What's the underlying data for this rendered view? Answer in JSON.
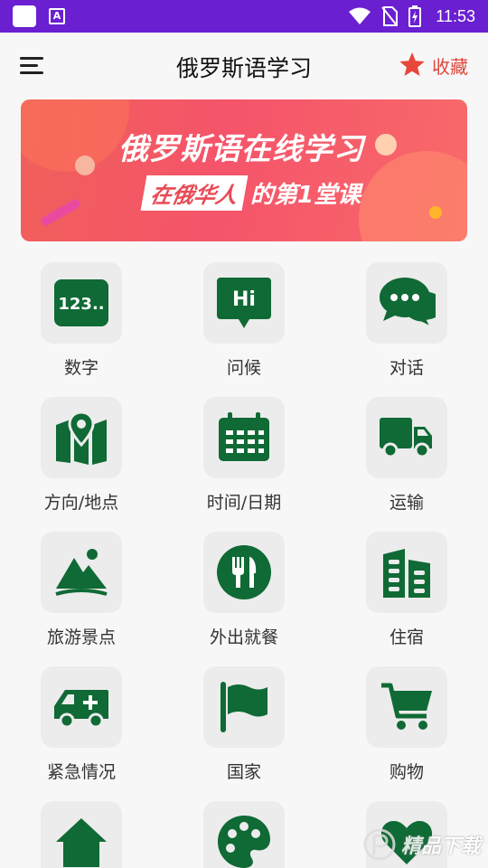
{
  "status_bar": {
    "time": "11:53",
    "app_glyph": "A"
  },
  "header": {
    "title": "俄罗斯语学习",
    "favorite_label": "收藏"
  },
  "banner": {
    "line1": "俄罗斯语在线学习",
    "chip": "在俄华人",
    "line2_rest": "的第1堂课"
  },
  "grid": {
    "items": [
      {
        "label": "数字",
        "icon": "number-icon"
      },
      {
        "label": "问候",
        "icon": "greeting-icon"
      },
      {
        "label": "对话",
        "icon": "chat-icon"
      },
      {
        "label": "方向/地点",
        "icon": "map-icon"
      },
      {
        "label": "时间/日期",
        "icon": "calendar-icon"
      },
      {
        "label": "运输",
        "icon": "truck-icon"
      },
      {
        "label": "旅游景点",
        "icon": "mountain-icon"
      },
      {
        "label": "外出就餐",
        "icon": "dining-icon"
      },
      {
        "label": "住宿",
        "icon": "building-icon"
      },
      {
        "label": "紧急情况",
        "icon": "ambulance-icon"
      },
      {
        "label": "国家",
        "icon": "flag-icon"
      },
      {
        "label": "购物",
        "icon": "cart-icon"
      }
    ],
    "number_icon_text": "123..",
    "greeting_icon_text": "Hi"
  },
  "colors": {
    "icon_green": "#0f6a35",
    "accent_red": "#e0463a",
    "status_bar": "#6a1fd1"
  },
  "watermark": {
    "text": "精品下载"
  }
}
